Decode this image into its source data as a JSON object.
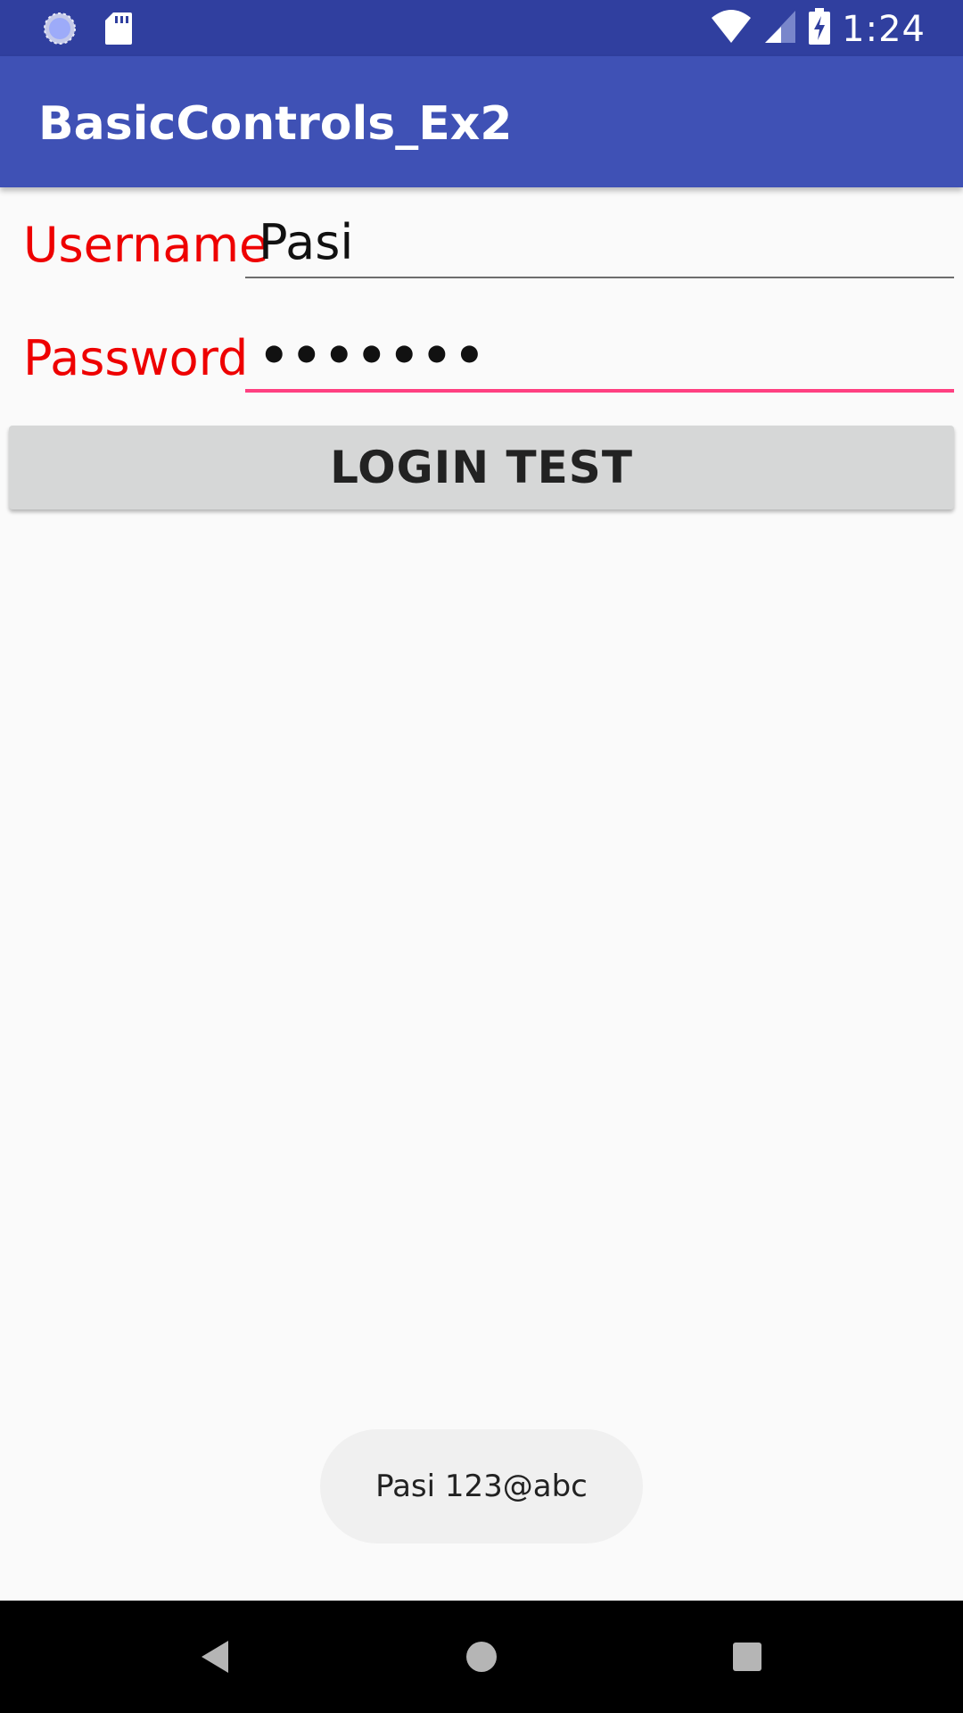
{
  "status_bar": {
    "time": "1:24",
    "left_icons": [
      "sync-icon",
      "sd-card-icon"
    ],
    "right_icons": [
      "wifi-icon",
      "cell-signal-icon",
      "battery-charging-icon"
    ]
  },
  "app_bar": {
    "title": "BasicControls_Ex2",
    "color": "#3f51b5",
    "status_color": "#303f9f"
  },
  "form": {
    "username_label": "Username",
    "username_value": "Pasi",
    "password_label": "Password",
    "password_value": "•••••••",
    "label_color": "#ee0000",
    "focus_color": "#ff4081"
  },
  "button": {
    "login_label": "LOGIN TEST"
  },
  "toast": {
    "message": "Pasi 123@abc"
  },
  "nav_bar": {
    "icons": [
      "back-icon",
      "home-icon",
      "recents-icon"
    ]
  }
}
